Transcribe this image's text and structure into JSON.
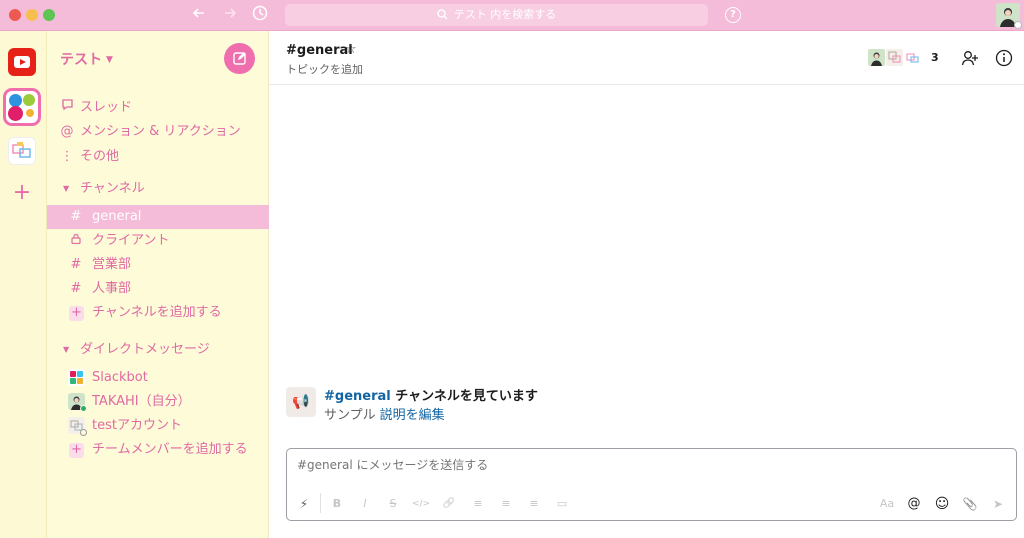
{
  "titlebar": {
    "search_placeholder": "テスト 内を検索する",
    "back_icon": "arrow-left-icon",
    "forward_icon": "arrow-right-icon",
    "history_icon": "clock-icon",
    "help_icon": "question-icon",
    "help_glyph": "?"
  },
  "workspace": {
    "name": "テスト",
    "add_glyph": "+"
  },
  "sidebar": {
    "nav": [
      {
        "label": "スレッド",
        "icon": "thread-icon"
      },
      {
        "label": "メンション & リアクション",
        "icon": "at-icon"
      },
      {
        "label": "その他",
        "icon": "more-icon"
      }
    ],
    "channels_header": "チャンネル",
    "channels": [
      {
        "name": "general",
        "icon": "hash-icon",
        "glyph": "#",
        "active": true
      },
      {
        "name": "クライアント",
        "icon": "lock-icon",
        "glyph": "🔒",
        "active": false
      },
      {
        "name": "営業部",
        "icon": "hash-icon",
        "glyph": "#",
        "active": false
      },
      {
        "name": "人事部",
        "icon": "hash-icon",
        "glyph": "#",
        "active": false
      }
    ],
    "add_channel": "チャンネルを追加する",
    "dm_header": "ダイレクトメッセージ",
    "dms": [
      {
        "name": "Slackbot"
      },
      {
        "name": "TAKAHI（自分）"
      },
      {
        "name": "testアカウント"
      }
    ],
    "add_member": "チームメンバーを追加する",
    "plus_glyph": "+"
  },
  "channel": {
    "title": "#general",
    "topic_placeholder": "トピックを追加",
    "member_count": "3",
    "star_glyph": "☆"
  },
  "intro": {
    "channel": "#general",
    "title_rest": " チャンネルを見ています",
    "description": "サンプル",
    "edit_link": "説明を編集"
  },
  "composer": {
    "placeholder": "#general にメッセージを送信する",
    "toolbar": [
      {
        "name": "shortcuts-icon",
        "glyph": "⚡"
      },
      {
        "name": "bold-icon",
        "glyph": "B"
      },
      {
        "name": "italic-icon",
        "glyph": "I"
      },
      {
        "name": "strikethrough-icon",
        "glyph": "S"
      },
      {
        "name": "code-icon",
        "glyph": "</>"
      },
      {
        "name": "link-icon",
        "glyph": "🔗"
      },
      {
        "name": "ordered-list-icon",
        "glyph": "≡"
      },
      {
        "name": "bulleted-list-icon",
        "glyph": "≡"
      },
      {
        "name": "blockquote-icon",
        "glyph": "≡"
      },
      {
        "name": "code-block-icon",
        "glyph": "▭"
      },
      {
        "name": "formatting-toggle-icon",
        "glyph": "Aa"
      },
      {
        "name": "mention-icon",
        "glyph": "@"
      },
      {
        "name": "emoji-icon",
        "glyph": "☺"
      },
      {
        "name": "attach-icon",
        "glyph": "📎"
      },
      {
        "name": "send-icon",
        "glyph": "➤"
      }
    ]
  },
  "colors": {
    "accent": "#ef6fae",
    "titlebar": "#f5bcd9",
    "sidebar_bg": "#fdfbd8",
    "link": "#1264a3"
  }
}
